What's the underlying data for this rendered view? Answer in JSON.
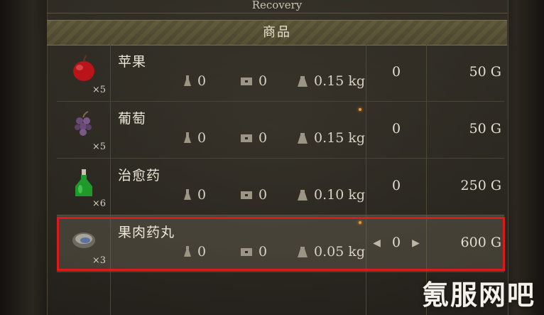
{
  "category_title": "Recovery",
  "table_header": "商品",
  "items": [
    {
      "name": "苹果",
      "quantity": "×5",
      "stat_a": "0",
      "stat_b": "0",
      "weight": "0.15 kg",
      "count": "0",
      "price": "50 G",
      "icon": "apple-icon"
    },
    {
      "name": "葡萄",
      "quantity": "×5",
      "stat_a": "0",
      "stat_b": "0",
      "weight": "0.15 kg",
      "count": "0",
      "price": "50 G",
      "icon": "grapes-icon"
    },
    {
      "name": "治愈药",
      "quantity": "×6",
      "stat_a": "0",
      "stat_b": "0",
      "weight": "0.10 kg",
      "count": "0",
      "price": "250 G",
      "icon": "potion-icon"
    },
    {
      "name": "果肉药丸",
      "quantity": "×3",
      "stat_a": "0",
      "stat_b": "0",
      "weight": "0.05 kg",
      "count": "0",
      "price": "600 G",
      "icon": "pill-icon",
      "selected": true
    }
  ],
  "stepper": {
    "left_arrow": "◀",
    "right_arrow": "▶"
  },
  "watermark": "氪服网吧",
  "colors": {
    "selection_border": "#d81c1c",
    "spark": "#e79a3a"
  }
}
